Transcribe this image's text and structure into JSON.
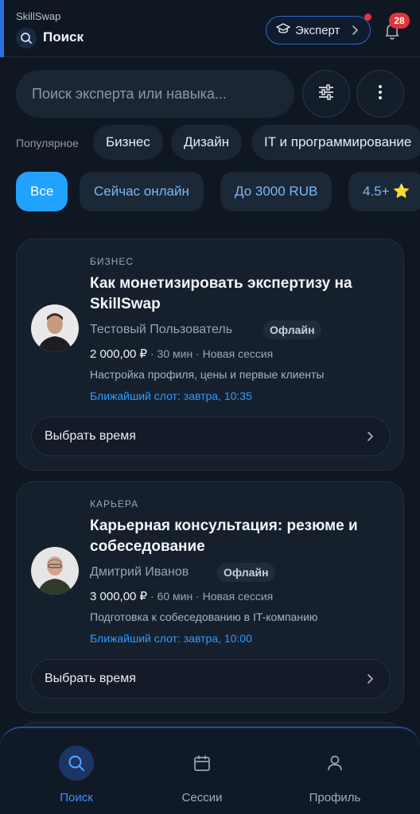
{
  "header": {
    "app_name": "SkillSwap",
    "title": "Поиск",
    "expert_label": "Эксперт",
    "notification_count": "28"
  },
  "search": {
    "placeholder": "Поиск эксперта или навыка..."
  },
  "popular": {
    "label": "Популярное",
    "chips": [
      "Бизнес",
      "Дизайн",
      "IT и программирование"
    ]
  },
  "filters": [
    "Все",
    "Сейчас онлайн",
    "До 3000 RUB",
    "4.5+ ⭐"
  ],
  "cards": [
    {
      "category": "БИЗНЕС",
      "title": "Как монетизировать экспертизу на SkillSwap",
      "author": "Тестовый Пользователь",
      "status": "Офлайн",
      "price": "2 000,00 ₽",
      "meta": " · 30 мин · Новая сессия",
      "description": "Настройка профиля, цены и первые клиенты",
      "slot": "Ближайший слот: завтра, 10:35",
      "button": "Выбрать время"
    },
    {
      "category": "КАРЬЕРА",
      "title": "Карьерная консультация: резюме и собеседование",
      "author": "Дмитрий Иванов",
      "status": "Офлайн",
      "price": "3 000,00 ₽",
      "meta": " · 60 мин · Новая сессия",
      "description": "Подготовка к собеседованию в IT-компанию",
      "slot": "Ближайший слот: завтра, 10:00",
      "button": "Выбрать время"
    }
  ],
  "nav": [
    {
      "label": "Поиск",
      "icon": "search-icon",
      "active": true
    },
    {
      "label": "Сессии",
      "icon": "calendar-icon",
      "active": false
    },
    {
      "label": "Профиль",
      "icon": "user-icon",
      "active": false
    }
  ],
  "colors": {
    "background": "#0f1723",
    "accent": "#22a2ff",
    "link": "#2f9bff",
    "badge": "#e2353b"
  }
}
